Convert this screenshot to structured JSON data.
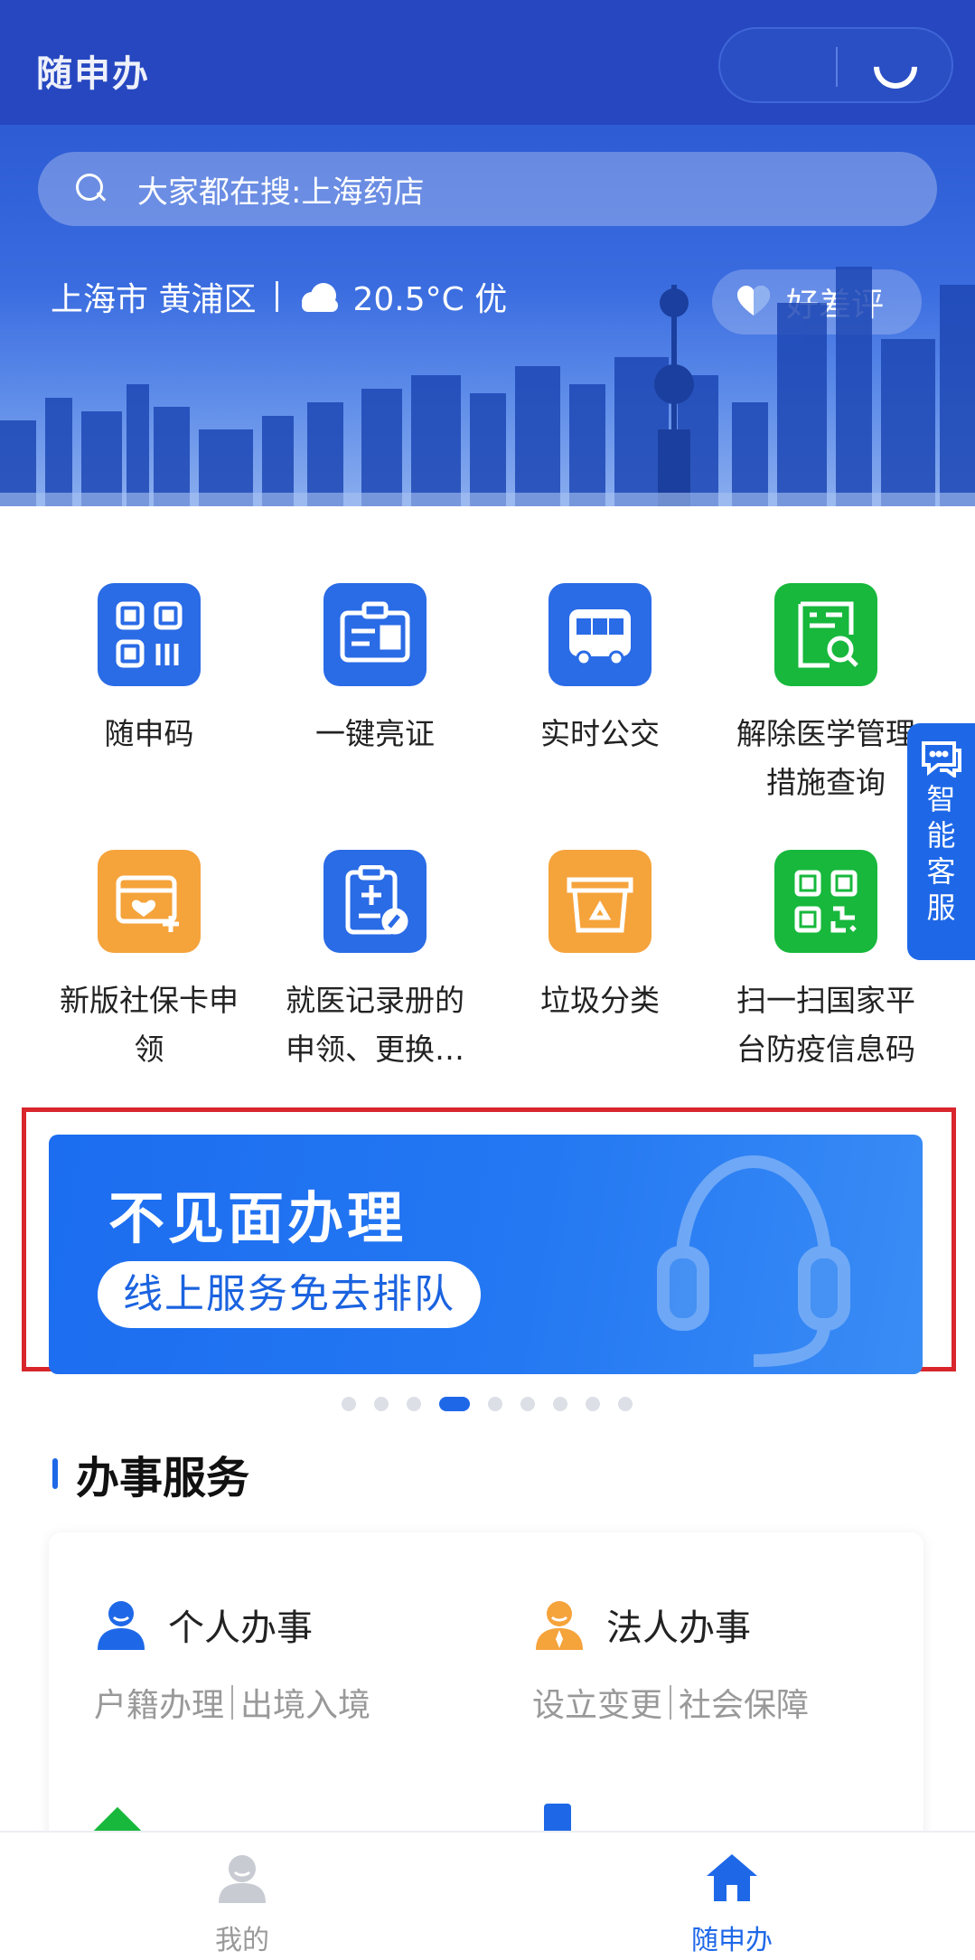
{
  "header": {
    "app_title": "随申办",
    "search_placeholder": "大家都在搜:上海药店",
    "location": "上海市 黄浦区",
    "weather": "20.5°C 优",
    "rating_label": "好差评"
  },
  "quick_services": [
    {
      "label": "随申码",
      "icon": "qr-code-icon",
      "color": "#2a6be6"
    },
    {
      "label": "一键亮证",
      "icon": "id-card-icon",
      "color": "#2a6be6"
    },
    {
      "label": "实时公交",
      "icon": "bus-icon",
      "color": "#2a6be6"
    },
    {
      "label": "解除医学管理措施查询",
      "line1": "解除医学管理",
      "line2": "措施查询",
      "icon": "medical-search-icon",
      "color": "#17b83c"
    },
    {
      "label": "新版社保卡申领",
      "line1": "新版社保卡申",
      "line2": "领",
      "icon": "social-card-icon",
      "color": "#f5a33b"
    },
    {
      "label": "就医记录册的申领、更换…",
      "line1": "就医记录册的",
      "line2": "申领、更换…",
      "icon": "medical-record-icon",
      "color": "#2a6be6"
    },
    {
      "label": "垃圾分类",
      "icon": "garbage-bin-icon",
      "color": "#f5a33b"
    },
    {
      "label": "扫一扫国家平台防疫信息码",
      "line1": "扫一扫国家平",
      "line2": "台防疫信息码",
      "icon": "scan-qr-icon",
      "color": "#17b83c"
    }
  ],
  "side_widget": {
    "label": "智能客服"
  },
  "banner": {
    "title": "不见面办理",
    "subtitle": "线上服务免去排队",
    "dots_total": 9,
    "active_dot": 4
  },
  "section": {
    "title": "办事服务"
  },
  "services": [
    {
      "name": "个人办事",
      "sub1": "户籍办理",
      "sub2": "出境入境",
      "icon": "person-icon",
      "color": "#1e68e8"
    },
    {
      "name": "法人办事",
      "sub1": "设立变更",
      "sub2": "社会保障",
      "icon": "corporate-person-icon",
      "color": "#f5a33b"
    }
  ],
  "bottom_nav": [
    {
      "label": "我的",
      "icon": "profile-icon",
      "active": false
    },
    {
      "label": "随申办",
      "icon": "home-icon",
      "active": true
    }
  ]
}
